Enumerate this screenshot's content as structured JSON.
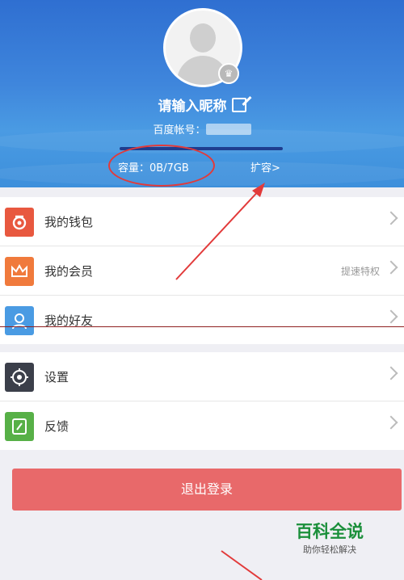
{
  "profile": {
    "nickname": "请输入昵称",
    "account_label": "百度帐号：",
    "capacity": "容量：0B/7GB",
    "expand_label": "扩容>"
  },
  "menu1": [
    {
      "label": "我的钱包",
      "icon": "wallet-icon",
      "color": "#e8583f",
      "extra": ""
    },
    {
      "label": "我的会员",
      "icon": "crown-icon",
      "color": "#f07a3c",
      "extra": "提速特权"
    },
    {
      "label": "我的好友",
      "icon": "friend-icon",
      "color": "#4a9be3",
      "extra": ""
    }
  ],
  "menu2": [
    {
      "label": "设置",
      "icon": "gear-icon",
      "color": "#3b3f4a",
      "extra": ""
    },
    {
      "label": "反馈",
      "icon": "feedback-icon",
      "color": "#57b047",
      "extra": ""
    }
  ],
  "logout_label": "退出登录",
  "watermark": {
    "title": "百科全说",
    "subtitle": "助你轻松解决"
  },
  "colors": {
    "header": "#3f86dc",
    "logout": "#e8696a",
    "annotation": "#e23a3a"
  }
}
